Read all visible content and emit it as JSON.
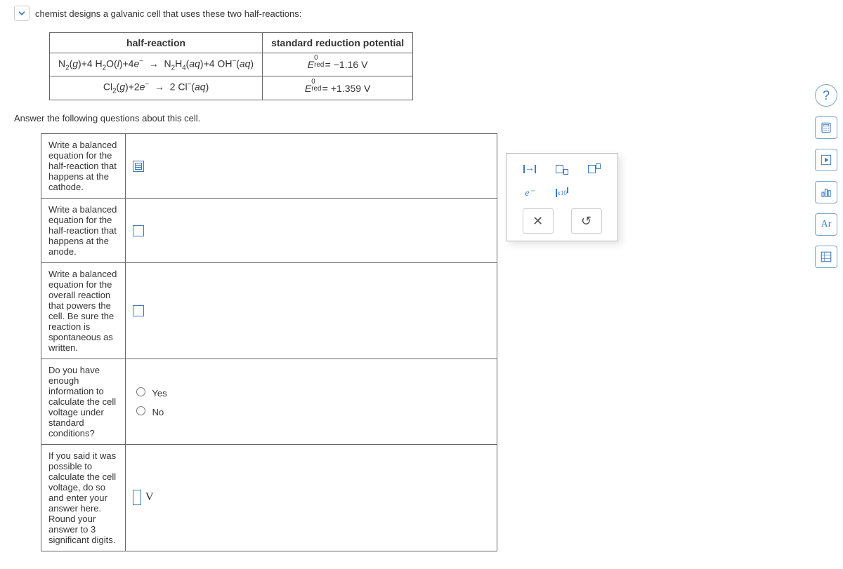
{
  "header": {
    "intro": "chemist designs a galvanic cell that uses these two half-reactions:"
  },
  "table": {
    "col1": "half-reaction",
    "col2": "standard reduction potential",
    "row1": {
      "reaction": "N₂(g) + 4 H₂O(l) + 4e⁻  →  N₂H₄(aq) + 4 OH⁻(aq)",
      "potential_label": "E⁰red",
      "potential_value": "= −1.16 V"
    },
    "row2": {
      "reaction": "Cl₂(g) + 2e⁻  →  2 Cl⁻(aq)",
      "potential_label": "E⁰red",
      "potential_value": "= +1.359 V"
    }
  },
  "subtitle": "Answer the following questions about this cell.",
  "questions": {
    "q1": "Write a balanced equation for the half-reaction that happens at the cathode.",
    "q2": "Write a balanced equation for the half-reaction that happens at the anode.",
    "q3": "Write a balanced equation for the overall reaction that powers the cell. Be sure the reaction is spontaneous as written.",
    "q4": "Do you have enough information to calculate the cell voltage under standard conditions?",
    "q4_yes": "Yes",
    "q4_no": "No",
    "q5": "If you said it was possible to calculate the cell voltage, do so and enter your answer here. Round your answer to 3 significant digits.",
    "q5_unit": "V"
  },
  "palette": {
    "arrow": "→",
    "electron": "e⁻",
    "x10": "x10",
    "clear": "✕",
    "reset": "↺"
  },
  "sidebar": {
    "help": "?",
    "calc": "calc",
    "play": "play",
    "bars": "bars",
    "ar": "Ar",
    "table": "table"
  }
}
